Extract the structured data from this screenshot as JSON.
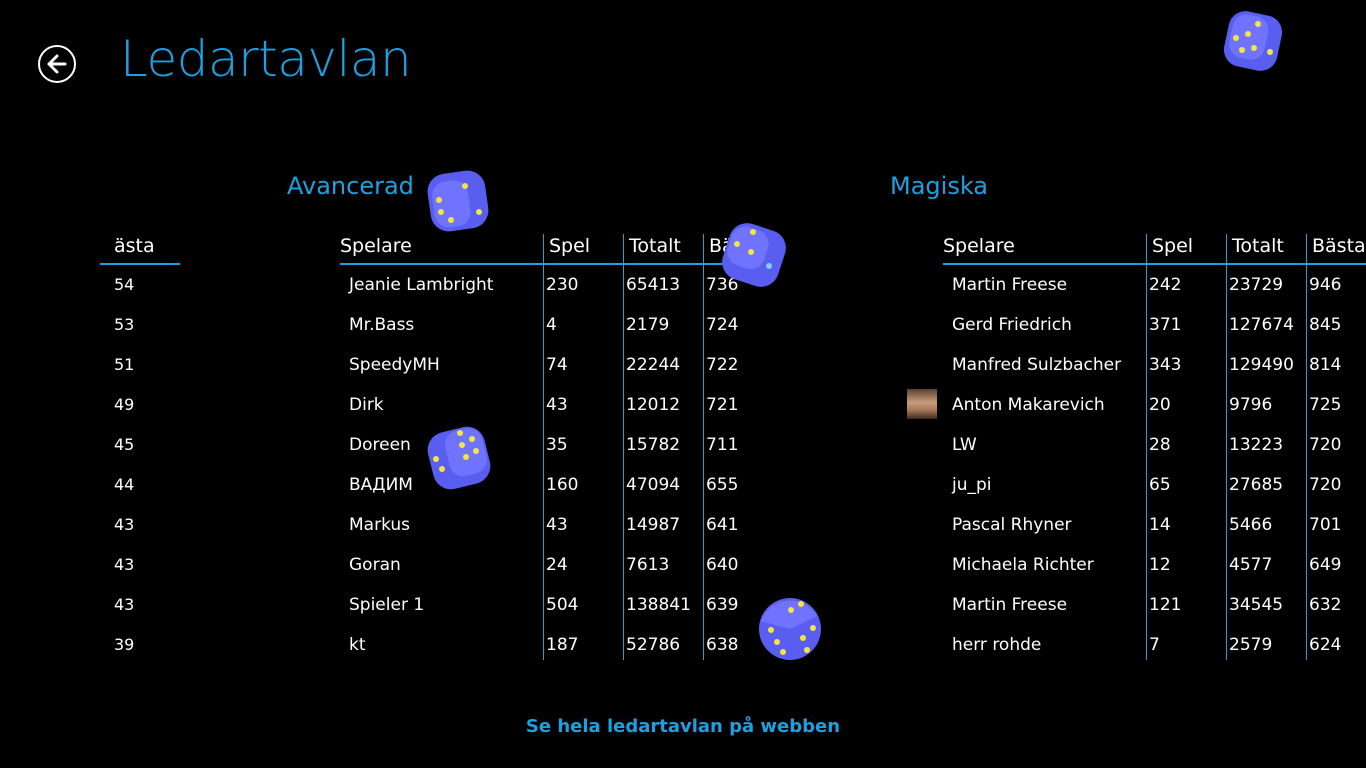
{
  "header": {
    "title": "Ledartavlan",
    "back_icon": "back-arrow-icon"
  },
  "left_fragment": {
    "header": "ästa",
    "values": [
      "54",
      "53",
      "51",
      "49",
      "45",
      "44",
      "43",
      "43",
      "43",
      "39"
    ]
  },
  "boards": [
    {
      "title": "Avancerad",
      "columns": [
        "Spelare",
        "Spel",
        "Totalt",
        "Bästa"
      ],
      "rows": [
        [
          "Jeanie Lambright",
          "230",
          "65413",
          "736"
        ],
        [
          "Mr.Bass",
          "4",
          "2179",
          "724"
        ],
        [
          "SpeedyMH",
          "74",
          "22244",
          "722"
        ],
        [
          "Dirk",
          "43",
          "12012",
          "721"
        ],
        [
          "Doreen",
          "35",
          "15782",
          "711"
        ],
        [
          "ВАДИМ",
          "160",
          "47094",
          "655"
        ],
        [
          "Markus",
          "43",
          "14987",
          "641"
        ],
        [
          "Goran",
          "24",
          "7613",
          "640"
        ],
        [
          "Spieler 1",
          "504",
          "138841",
          "639"
        ],
        [
          "kt",
          "187",
          "52786",
          "638"
        ]
      ]
    },
    {
      "title": "Magiska",
      "columns": [
        "Spelare",
        "Spel",
        "Totalt",
        "Bästa"
      ],
      "rows": [
        [
          "Martin Freese",
          "242",
          "23729",
          "946"
        ],
        [
          "Gerd Friedrich",
          "371",
          "127674",
          "845"
        ],
        [
          "Manfred Sulzbacher",
          "343",
          "129490",
          "814"
        ],
        [
          "Anton Makarevich",
          "20",
          "9796",
          "725"
        ],
        [
          "LW",
          "28",
          "13223",
          "720"
        ],
        [
          "ju_pi",
          "65",
          "27685",
          "720"
        ],
        [
          "Pascal Rhyner",
          "14",
          "5466",
          "701"
        ],
        [
          "Michaela Richter",
          "12",
          "4577",
          "649"
        ],
        [
          "Martin Freese",
          "121",
          "34545",
          "632"
        ],
        [
          "herr rohde",
          "7",
          "2579",
          "624"
        ]
      ]
    }
  ],
  "footer": {
    "link_label": "Se hela ledartavlan på webben"
  },
  "colors": {
    "accent": "#1ba1e2",
    "background": "#000000",
    "die": "#5a5ef0",
    "pip": "#f2e640"
  },
  "decor": {
    "die_icon": "dice-icon"
  }
}
